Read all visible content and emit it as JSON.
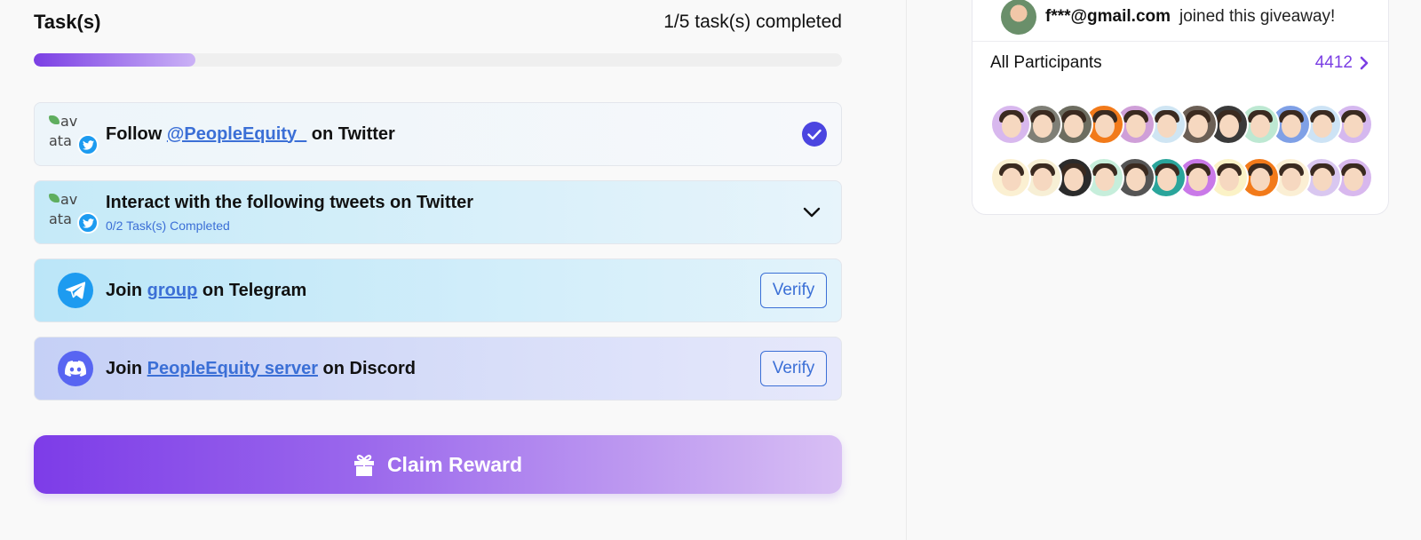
{
  "tasks": {
    "title": "Task(s)",
    "progress_text": "1/5 task(s) completed",
    "progress_fraction": 0.2,
    "items": [
      {
        "prefix": "Follow ",
        "link": "@PeopleEquity_",
        "suffix": " on Twitter",
        "status": "completed",
        "icon": "twitter-avatar-icon",
        "broken_img_alt": "av",
        "broken_img_alt2": "ata"
      },
      {
        "title": "Interact with the following tweets on Twitter",
        "sub": "0/2 Task(s) Completed",
        "icon": "twitter-avatar-icon",
        "broken_img_alt": "av",
        "broken_img_alt2": "ata"
      },
      {
        "prefix": "Join ",
        "link": "group",
        "suffix": " on Telegram",
        "action": "Verify",
        "icon": "telegram-icon"
      },
      {
        "prefix": "Join ",
        "link": "PeopleEquity server",
        "suffix": " on Discord",
        "action": "Verify",
        "icon": "discord-icon"
      }
    ],
    "claim_label": "Claim Reward"
  },
  "sidebar": {
    "joined_email": "f***@gmail.com",
    "joined_text": "joined this giveaway!",
    "participants_label": "All Participants",
    "participants_count": "4412"
  },
  "colors": {
    "accent": "#7b3fe4",
    "link": "#3b6fd6",
    "check": "#4b45e0",
    "telegram": "#1d9bf0",
    "discord": "#5865f2"
  }
}
